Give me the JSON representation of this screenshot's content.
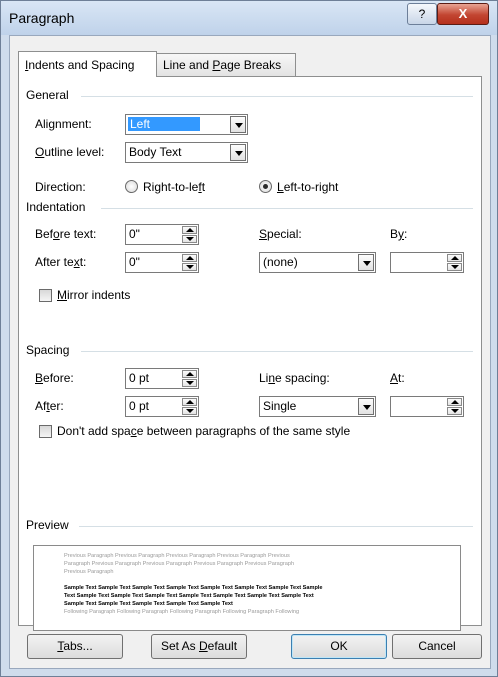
{
  "window": {
    "title": "Paragraph",
    "help_label": "?",
    "close_label": "X"
  },
  "tabs": [
    {
      "label": "Indents and Spacing",
      "pre": "",
      "accel": "I",
      "post": "ndents and Spacing"
    },
    {
      "label": "Line and Page Breaks",
      "pre": "Line and ",
      "accel": "P",
      "post": "age Breaks"
    }
  ],
  "general": {
    "heading": "General",
    "alignment": {
      "label": "Alignment:",
      "label_pre": "Ali",
      "label_accel": "g",
      "label_post": "nment:",
      "value": "Left"
    },
    "outline": {
      "label": "Outline level:",
      "label_pre": "",
      "label_accel": "O",
      "label_post": "utline level:",
      "value": "Body Text"
    },
    "direction": {
      "label": "Direction:",
      "rtl": {
        "pre": "Right-to-le",
        "accel": "f",
        "post": "t",
        "selected": false
      },
      "ltr": {
        "pre": "",
        "accel": "L",
        "post": "eft-to-right",
        "selected": true
      }
    }
  },
  "indentation": {
    "heading": "Indentation",
    "before": {
      "pre": "Bef",
      "accel": "o",
      "post": "re text:",
      "value": "0\""
    },
    "after": {
      "pre": "After te",
      "accel": "x",
      "post": "t:",
      "value": "0\""
    },
    "special": {
      "pre": "",
      "accel": "S",
      "post": "pecial:",
      "value": "(none)"
    },
    "by": {
      "pre": "B",
      "accel": "y",
      "post": ":",
      "value": ""
    },
    "mirror": {
      "pre": "",
      "accel": "M",
      "post": "irror indents",
      "checked": false
    }
  },
  "spacing": {
    "heading": "Spacing",
    "before": {
      "pre": "",
      "accel": "B",
      "post": "efore:",
      "value": "0 pt"
    },
    "after": {
      "pre": "Af",
      "accel": "t",
      "post": "er:",
      "value": "0 pt"
    },
    "line_spacing": {
      "pre": "Li",
      "accel": "n",
      "post": "e spacing:",
      "value": "Single"
    },
    "at": {
      "pre": "",
      "accel": "A",
      "post": "t:",
      "value": ""
    },
    "dont_add": {
      "pre": "Don't add spa",
      "accel": "c",
      "post": "e between paragraphs of the same style",
      "checked": false
    }
  },
  "preview": {
    "heading": "Preview",
    "previous_lines": [
      "Previous Paragraph Previous Paragraph Previous Paragraph Previous Paragraph Previous",
      "Paragraph Previous Paragraph Previous Paragraph Previous Paragraph Previous Paragraph",
      "Previous Paragraph"
    ],
    "sample_lines": [
      "Sample Text Sample Text Sample Text Sample Text Sample Text Sample Text Sample Text Sample",
      "Text Sample Text Sample Text Sample Text Sample Text Sample Text Sample Text Sample Text",
      "Sample Text Sample Text Sample Text Sample Text Sample Text"
    ],
    "following_lines": [
      "Following Paragraph Following Paragraph Following Paragraph Following Paragraph Following"
    ]
  },
  "buttons": {
    "tabs": {
      "pre": "",
      "accel": "T",
      "post": "abs..."
    },
    "set_default": {
      "pre": "Set As ",
      "accel": "D",
      "post": "efault"
    },
    "ok": "OK",
    "cancel": "Cancel"
  }
}
